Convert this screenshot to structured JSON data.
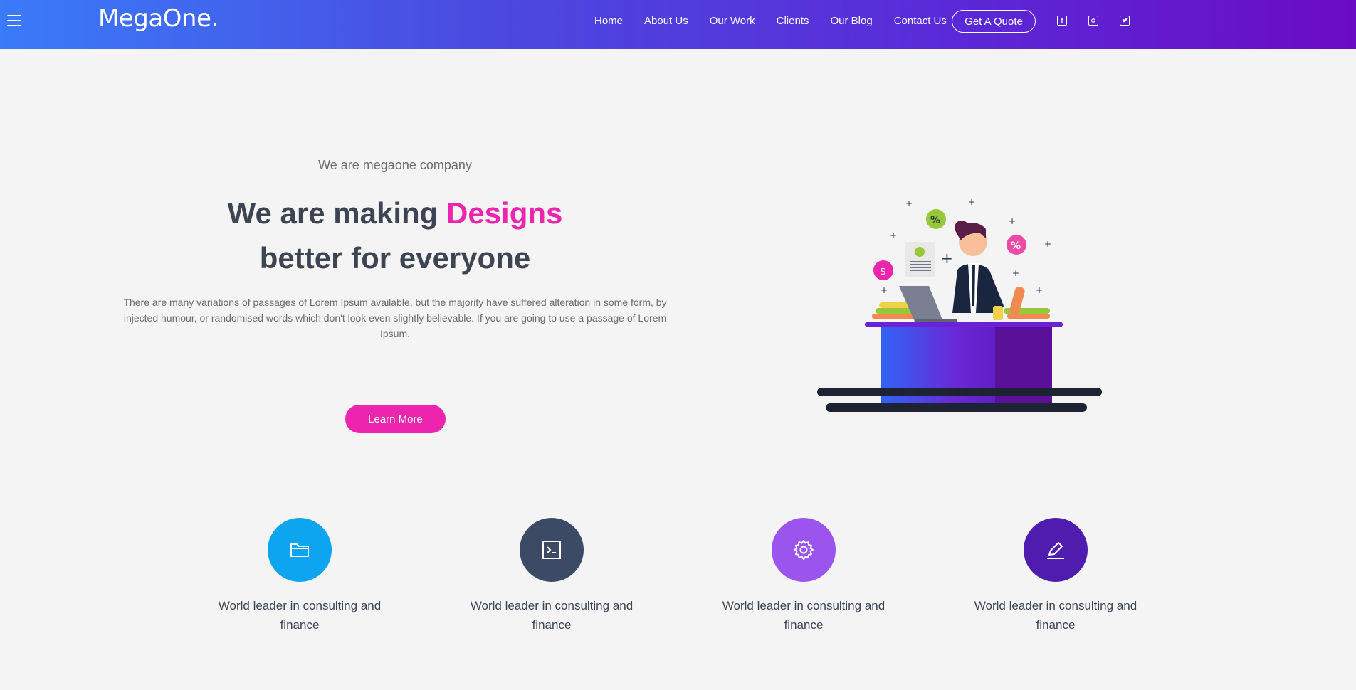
{
  "header": {
    "logo": "MegaOne.",
    "nav": [
      "Home",
      "About Us",
      "Our Work",
      "Clients",
      "Our Blog",
      "Contact Us"
    ],
    "quote_button": "Get A Quote",
    "social": [
      "facebook-icon",
      "instagram-icon",
      "twitter-icon"
    ]
  },
  "hero": {
    "subtitle": "We are megaone company",
    "title_part1": "We are making ",
    "title_accent": "Designs",
    "title_part2": "better for everyone",
    "description": "There are many variations of passages of Lorem Ipsum available, but the majority have suffered alteration in some form, by injected humour, or randomised words which don't look even slightly believable. If you are going to use a passage of Lorem Ipsum.",
    "button": "Learn More"
  },
  "features": [
    {
      "icon": "folder-icon",
      "label": "World leader in consulting and finance",
      "color": "#0ea5f0"
    },
    {
      "icon": "terminal-icon",
      "label": "World leader in consulting and finance",
      "color": "#3d4a66"
    },
    {
      "icon": "gear-icon",
      "label": "World leader in consulting and finance",
      "color": "#9b55ee"
    },
    {
      "icon": "edit-icon",
      "label": "World leader in consulting and finance",
      "color": "#4e1db0"
    }
  ],
  "colors": {
    "accent": "#ec24ae",
    "header_start": "#3a7bfa",
    "header_end": "#6b0cc4"
  }
}
